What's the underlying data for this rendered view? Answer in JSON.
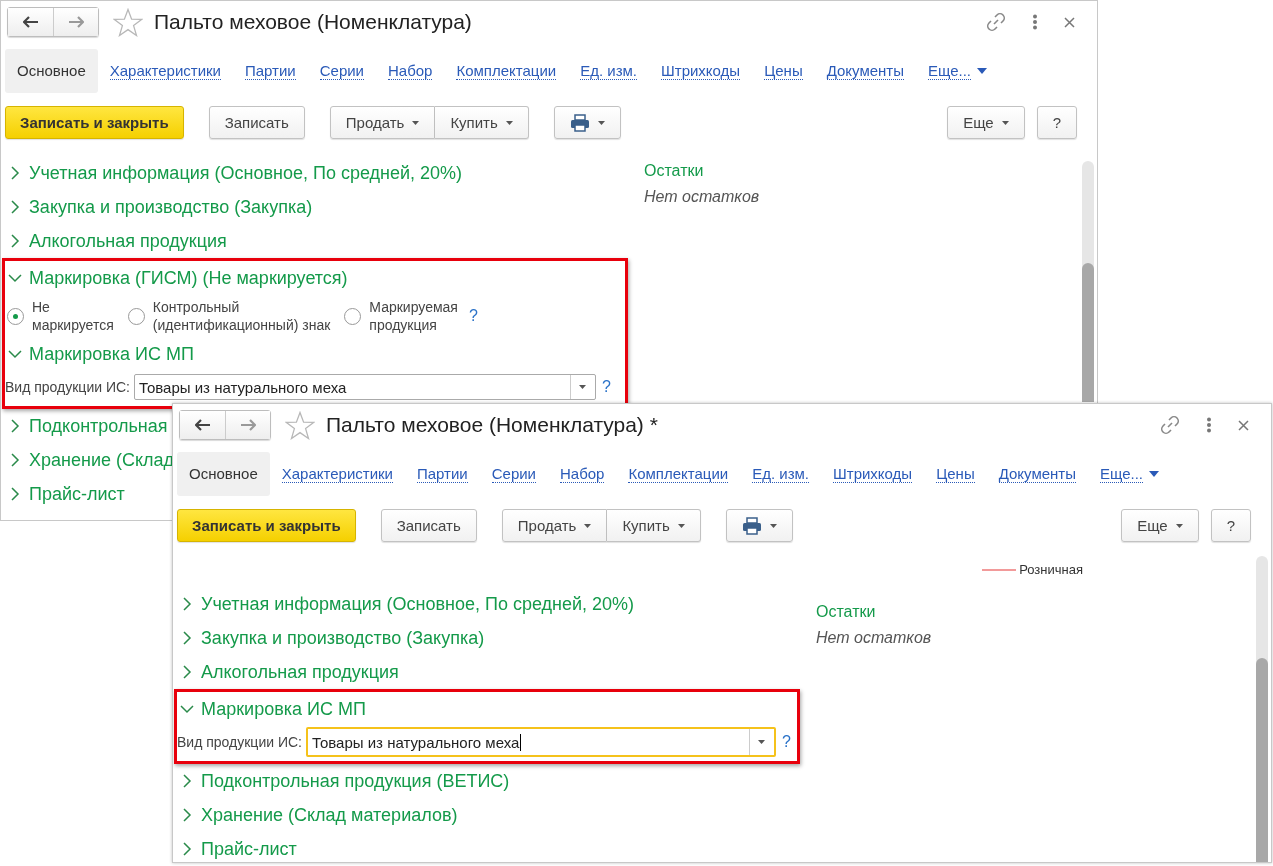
{
  "windows": [
    {
      "title": "Пальто меховое (Номенклатура)",
      "tabs": [
        {
          "label": "Основное",
          "selected": true,
          "kind": "tab"
        },
        {
          "label": "Характеристики",
          "selected": false,
          "kind": "tab"
        },
        {
          "label": "Партии",
          "selected": false,
          "kind": "tab"
        },
        {
          "label": "Серии",
          "selected": false,
          "kind": "tab"
        },
        {
          "label": "Набор",
          "selected": false,
          "kind": "tab"
        },
        {
          "label": "Комплектации",
          "selected": false,
          "kind": "tab"
        },
        {
          "label": "Ед. изм.",
          "selected": false,
          "kind": "tab"
        },
        {
          "label": "Штрихкоды",
          "selected": false,
          "kind": "tab"
        },
        {
          "label": "Цены",
          "selected": false,
          "kind": "tab"
        },
        {
          "label": "Документы",
          "selected": false,
          "kind": "tab"
        },
        {
          "label": "Еще...",
          "selected": false,
          "kind": "menu"
        }
      ],
      "toolbar": {
        "left": [
          [
            {
              "label": "Записать и закрыть",
              "kind": "primary"
            }
          ],
          [
            {
              "label": "Записать",
              "kind": "plain"
            }
          ],
          [
            {
              "label": "Продать",
              "kind": "menu"
            },
            {
              "label": "Купить",
              "kind": "menu"
            }
          ],
          [
            {
              "kind": "print"
            }
          ]
        ],
        "right": [
          [
            {
              "label": "Еще",
              "kind": "menu"
            }
          ],
          [
            {
              "label": "?",
              "kind": "plain"
            }
          ]
        ]
      },
      "sections": [
        {
          "title": "Учетная информация (Основное, По средней, 20%)",
          "expanded": false,
          "highlighted": false
        },
        {
          "title": "Закупка и производство (Закупка)",
          "expanded": false,
          "highlighted": false
        },
        {
          "title": "Алкогольная продукция",
          "expanded": false,
          "highlighted": false
        },
        {
          "title": "Маркировка (ГИСМ) (Не маркируется)",
          "expanded": true,
          "highlighted": true,
          "options": [
            {
              "label": "Не\nмаркируется",
              "selected": true
            },
            {
              "label": "Контрольный\n(идентификационный) знак",
              "selected": false
            },
            {
              "label": "Маркируемая\nпродукция",
              "selected": false
            }
          ],
          "help": "?"
        },
        {
          "title": "Маркировка ИС МП",
          "expanded": true,
          "highlighted": true,
          "field": {
            "label": "Вид продукции ИС:",
            "value": "Товары из натурального меха",
            "focused": false
          },
          "help": "?"
        },
        {
          "title": "Подконтрольная",
          "expanded": false,
          "highlighted": false
        },
        {
          "title": "Хранение (Склад",
          "expanded": false,
          "highlighted": false
        },
        {
          "title": "Прайс-лист",
          "expanded": false,
          "highlighted": false
        }
      ],
      "side": {
        "heading": "Остатки",
        "text": "Нет остатков"
      }
    },
    {
      "title": "Пальто меховое (Номенклатура) *",
      "tabs": [
        {
          "label": "Основное",
          "selected": true,
          "kind": "tab"
        },
        {
          "label": "Характеристики",
          "selected": false,
          "kind": "tab"
        },
        {
          "label": "Партии",
          "selected": false,
          "kind": "tab"
        },
        {
          "label": "Серии",
          "selected": false,
          "kind": "tab"
        },
        {
          "label": "Набор",
          "selected": false,
          "kind": "tab"
        },
        {
          "label": "Комплектации",
          "selected": false,
          "kind": "tab"
        },
        {
          "label": "Ед. изм.",
          "selected": false,
          "kind": "tab"
        },
        {
          "label": "Штрихкоды",
          "selected": false,
          "kind": "tab"
        },
        {
          "label": "Цены",
          "selected": false,
          "kind": "tab"
        },
        {
          "label": "Документы",
          "selected": false,
          "kind": "tab"
        },
        {
          "label": "Еще...",
          "selected": false,
          "kind": "menu"
        }
      ],
      "toolbar": {
        "left": [
          [
            {
              "label": "Записать и закрыть",
              "kind": "primary"
            }
          ],
          [
            {
              "label": "Записать",
              "kind": "plain"
            }
          ],
          [
            {
              "label": "Продать",
              "kind": "menu"
            },
            {
              "label": "Купить",
              "kind": "menu"
            }
          ],
          [
            {
              "kind": "print"
            }
          ]
        ],
        "right": [
          [
            {
              "label": "Еще",
              "kind": "menu"
            }
          ],
          [
            {
              "label": "?",
              "kind": "plain"
            }
          ]
        ]
      },
      "legend": {
        "label": "Розничная",
        "color": "#f29a9a"
      },
      "sections": [
        {
          "title": "Учетная информация (Основное, По средней, 20%)",
          "expanded": false,
          "highlighted": false
        },
        {
          "title": "Закупка и производство (Закупка)",
          "expanded": false,
          "highlighted": false
        },
        {
          "title": "Алкогольная продукция",
          "expanded": false,
          "highlighted": false
        },
        {
          "title": "Маркировка ИС МП",
          "expanded": true,
          "highlighted": true,
          "field": {
            "label": "Вид продукции ИС:",
            "value": "Товары из натурального меха",
            "focused": true
          },
          "help": "?"
        },
        {
          "title": "Подконтрольная продукция (ВЕТИС)",
          "expanded": false,
          "highlighted": false
        },
        {
          "title": "Хранение (Склад материалов)",
          "expanded": false,
          "highlighted": false
        },
        {
          "title": "Прайс-лист",
          "expanded": false,
          "highlighted": false
        }
      ],
      "side": {
        "heading": "Остатки",
        "text": "Нет остатков"
      }
    }
  ]
}
